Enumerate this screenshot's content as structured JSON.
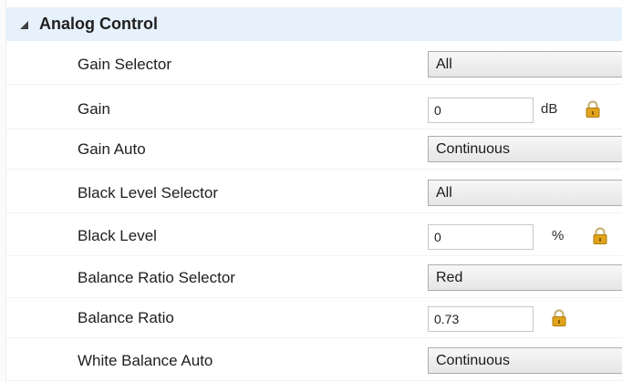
{
  "category": {
    "title": "Analog Control"
  },
  "rows": [
    {
      "label": "Gain Selector",
      "value": "All"
    },
    {
      "label": "Gain",
      "value": "0",
      "unit": "dB"
    },
    {
      "label": "Gain Auto",
      "value": "Continuous"
    },
    {
      "label": "Black Level Selector",
      "value": "All"
    },
    {
      "label": "Black Level",
      "value": "0",
      "unit": "%"
    },
    {
      "label": "Balance Ratio Selector",
      "value": "Red"
    },
    {
      "label": "Balance Ratio",
      "value": "0.73"
    },
    {
      "label": "White Balance Auto",
      "value": "Continuous"
    }
  ],
  "icons": {
    "lock": "lock-icon",
    "collapse": "collapse-arrow-icon"
  },
  "colors": {
    "header_bg": "#e7f1fb",
    "lock_body": "#e0a41c"
  }
}
